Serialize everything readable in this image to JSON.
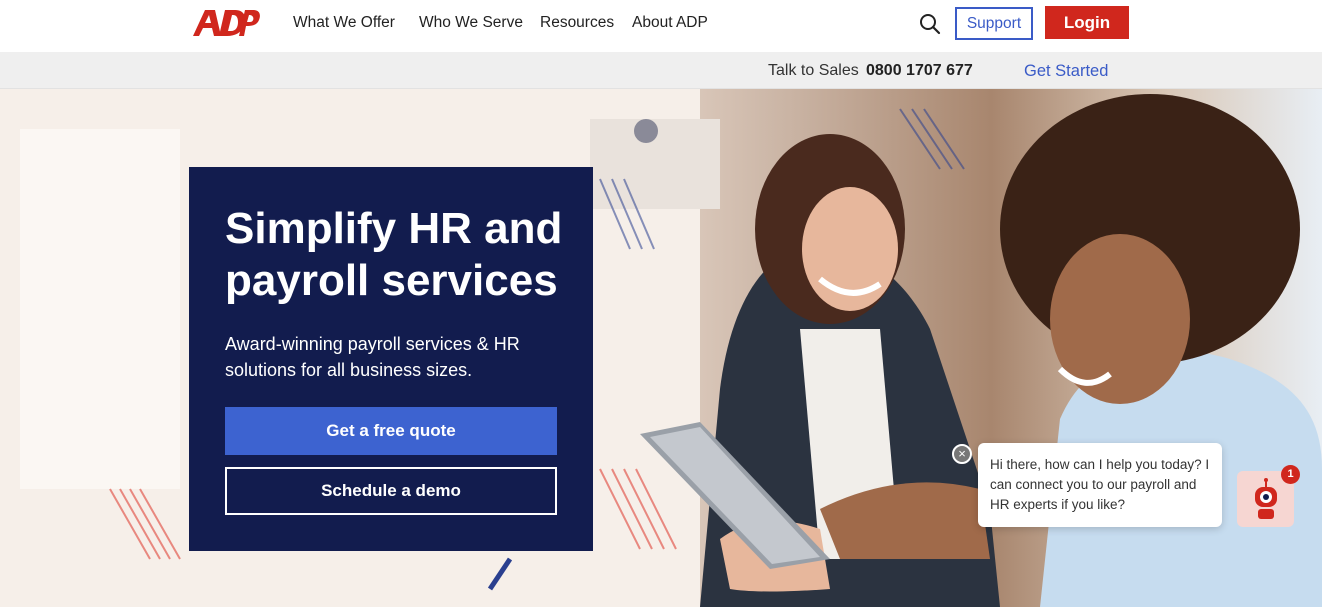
{
  "brand": {
    "name": "ADP",
    "color": "#d0271d"
  },
  "nav": {
    "items": [
      {
        "label": "What We Offer"
      },
      {
        "label": "Who We Serve"
      },
      {
        "label": "Resources"
      },
      {
        "label": "About ADP"
      }
    ],
    "search_icon": "search-icon",
    "support_label": "Support",
    "login_label": "Login"
  },
  "subbar": {
    "talk_label": "Talk to Sales",
    "phone": "0800 1707 677",
    "get_started": "Get Started"
  },
  "hero": {
    "title": "Simplify HR and payroll services",
    "subtitle": "Award-winning payroll services & HR solutions for all business sizes.",
    "primary_cta": "Get a free quote",
    "secondary_cta": "Schedule a demo"
  },
  "chat": {
    "message": "Hi there, how can I help you today? I can connect you to our payroll and HR experts if you like?",
    "badge_count": "1",
    "close_icon": "close-icon",
    "bot_icon": "robot-icon"
  },
  "colors": {
    "navy": "#121c4e",
    "blue": "#3d63d0",
    "red": "#d0271d"
  }
}
